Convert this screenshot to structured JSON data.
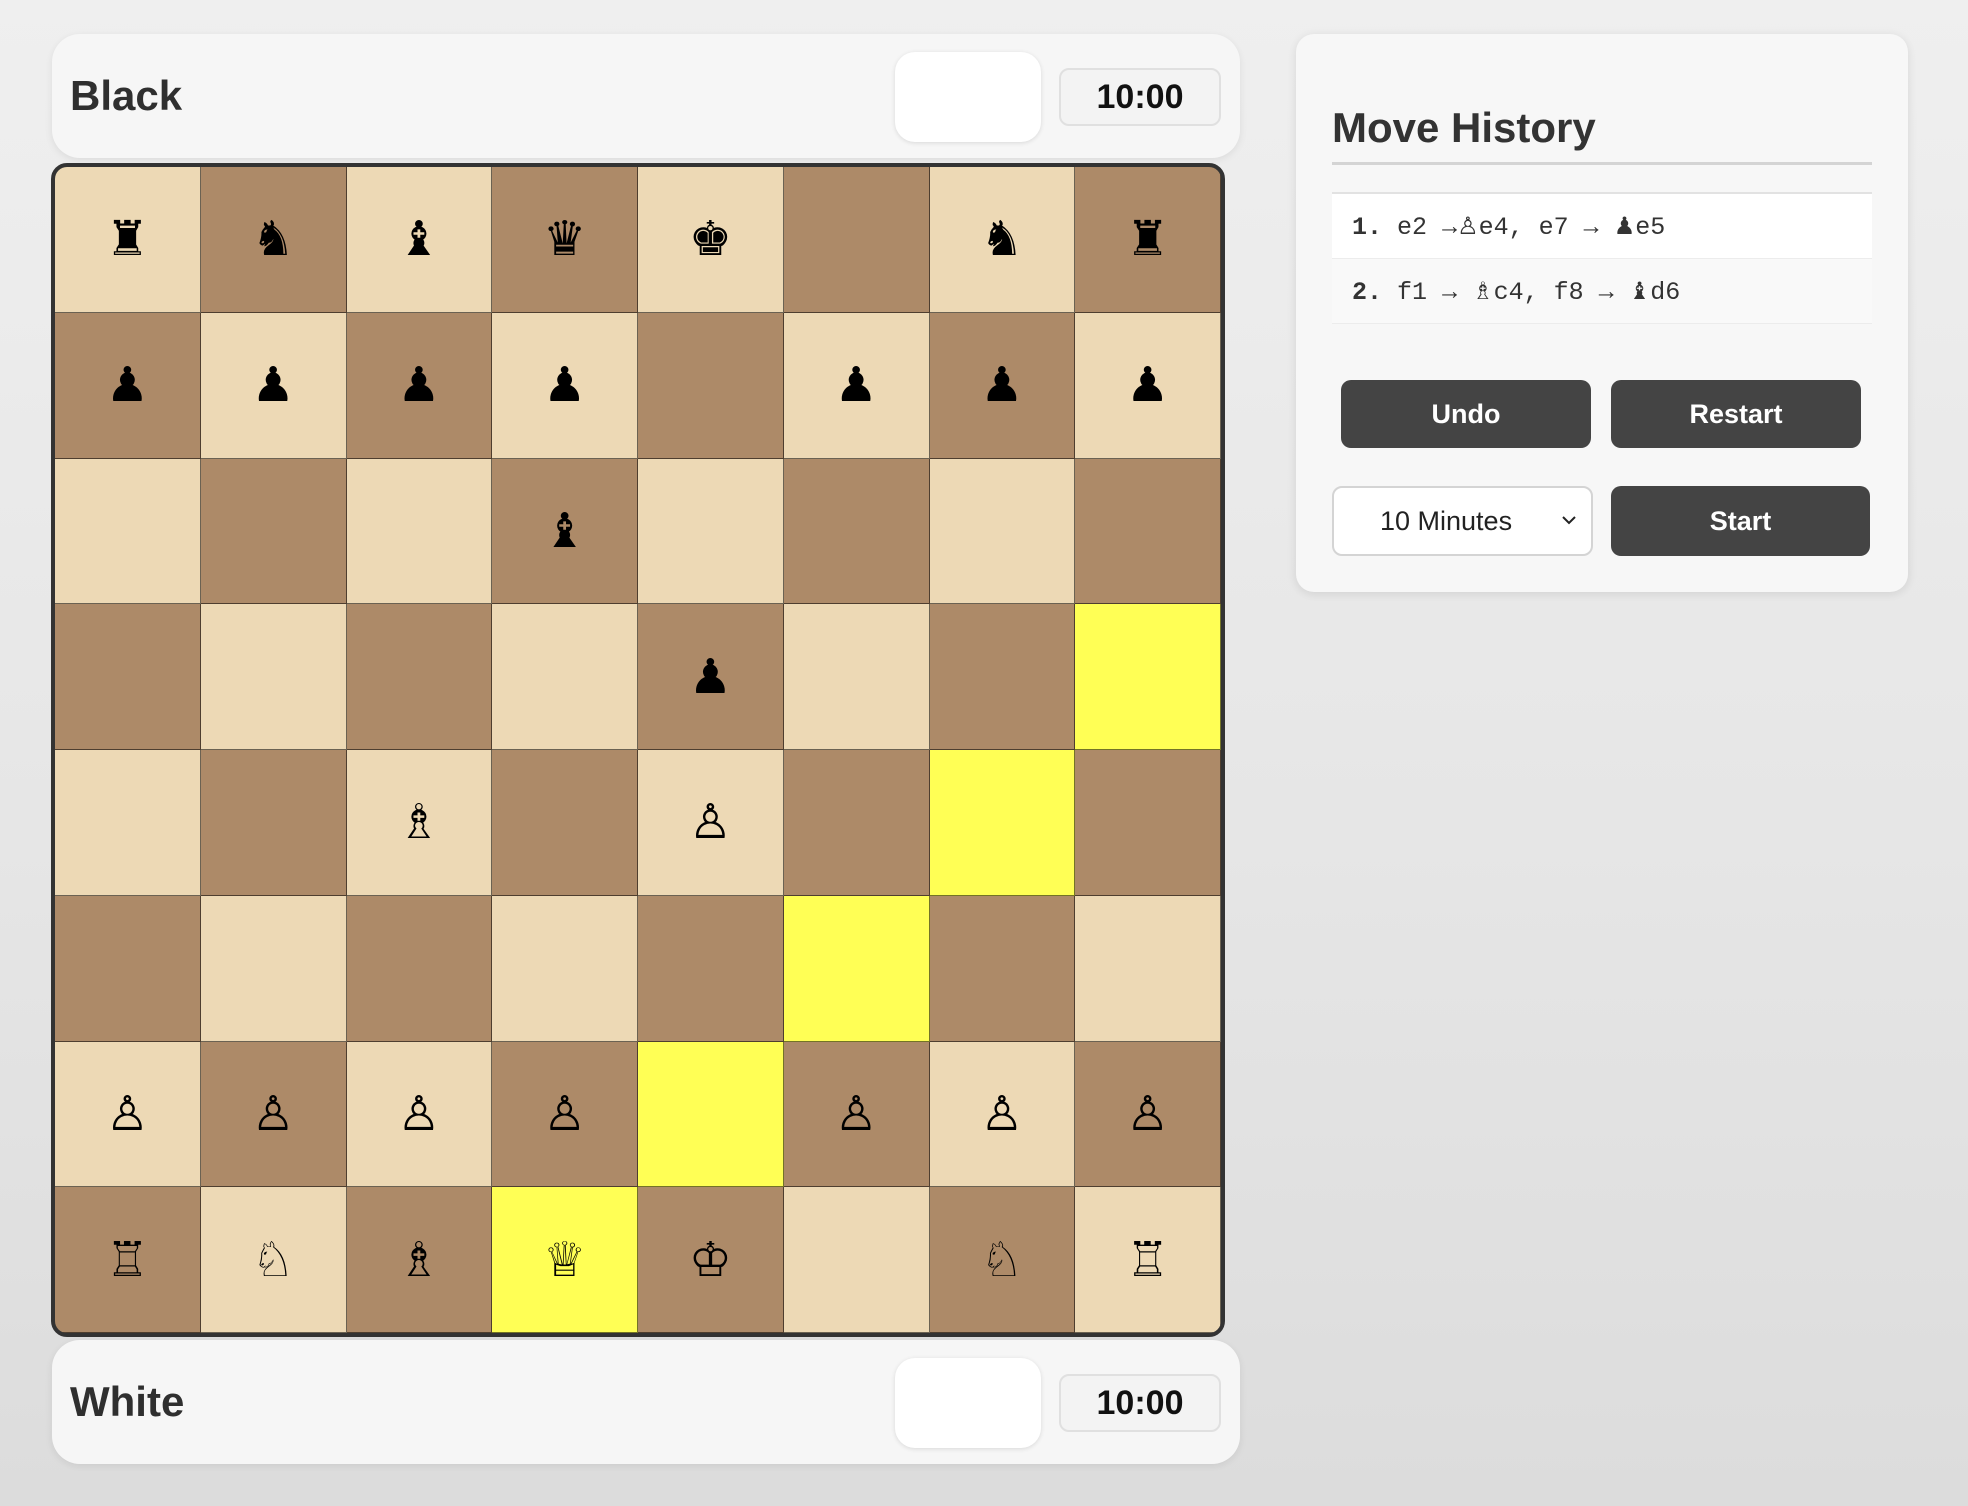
{
  "players": {
    "black": {
      "name": "Black",
      "clock": "10:00"
    },
    "white": {
      "name": "White",
      "clock": "10:00"
    }
  },
  "board": {
    "ranks": [
      [
        "♜",
        "♞",
        "♝",
        "♛",
        "♚",
        "",
        "♞",
        "♜"
      ],
      [
        "♟",
        "♟",
        "♟",
        "♟",
        "",
        "♟",
        "♟",
        "♟"
      ],
      [
        "",
        "",
        "",
        "♝",
        "",
        "",
        "",
        ""
      ],
      [
        "",
        "",
        "",
        "",
        "♟",
        "",
        "",
        ""
      ],
      [
        "",
        "",
        "♗",
        "",
        "♙",
        "",
        "",
        ""
      ],
      [
        "",
        "",
        "",
        "",
        "",
        "",
        "",
        ""
      ],
      [
        "♙",
        "♙",
        "♙",
        "♙",
        "",
        "♙",
        "♙",
        "♙"
      ],
      [
        "♖",
        "♘",
        "♗",
        "♕",
        "♔",
        "",
        "♘",
        "♖"
      ]
    ],
    "highlighted": [
      "h5",
      "g4",
      "f3",
      "e2",
      "d1"
    ]
  },
  "history": {
    "title": "Move History",
    "moves": [
      {
        "num": "1.",
        "white_from": "e2",
        "arrow": "→",
        "white_piece": "♙",
        "white_to": "e4",
        "sep": ",",
        "black_from": "e7",
        "black_piece": "♟",
        "black_to": "e5"
      },
      {
        "num": "2.",
        "white_from": "f1",
        "arrow": "→",
        "white_piece": "♗",
        "white_to": "c4",
        "sep": ",",
        "black_from": "f8",
        "black_piece": "♝",
        "black_to": "d6"
      }
    ]
  },
  "controls": {
    "undo_label": "Undo",
    "restart_label": "Restart",
    "start_label": "Start",
    "time_select": {
      "selected": "10 Minutes"
    }
  },
  "colors": {
    "light_square": "#edd9b5",
    "dark_square": "#ad8a68",
    "highlight": "#ffff55",
    "button": "#444444"
  }
}
